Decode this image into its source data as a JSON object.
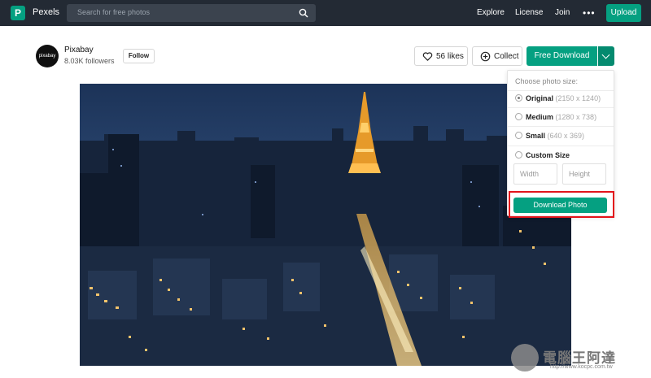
{
  "header": {
    "brand": "Pexels",
    "search_placeholder": "Search for free photos",
    "nav": [
      "Explore",
      "License",
      "Join"
    ],
    "upload_label": "Upload"
  },
  "profile": {
    "avatar_text": "pixabay",
    "name": "Pixabay",
    "followers": "8.03K followers",
    "follow_label": "Follow"
  },
  "actions": {
    "likes_label": "56 likes",
    "collect_label": "Collect",
    "free_download_label": "Free Download"
  },
  "dropdown": {
    "heading": "Choose photo size:",
    "options": [
      {
        "label": "Original",
        "dims": "(2150 x 1240)",
        "selected": true
      },
      {
        "label": "Medium",
        "dims": "(1280 x 738)",
        "selected": false
      },
      {
        "label": "Small",
        "dims": "(640 x 369)",
        "selected": false
      },
      {
        "label": "Custom Size",
        "dims": "",
        "selected": false
      }
    ],
    "width_placeholder": "Width",
    "height_placeholder": "Height",
    "download_photo_label": "Download Photo"
  },
  "watermark": {
    "text": "電腦王阿達",
    "url": "http://www.kocpc.com.tw"
  },
  "colors": {
    "accent": "#05a081",
    "topbar": "#232a34",
    "highlight": "#e3141b"
  }
}
